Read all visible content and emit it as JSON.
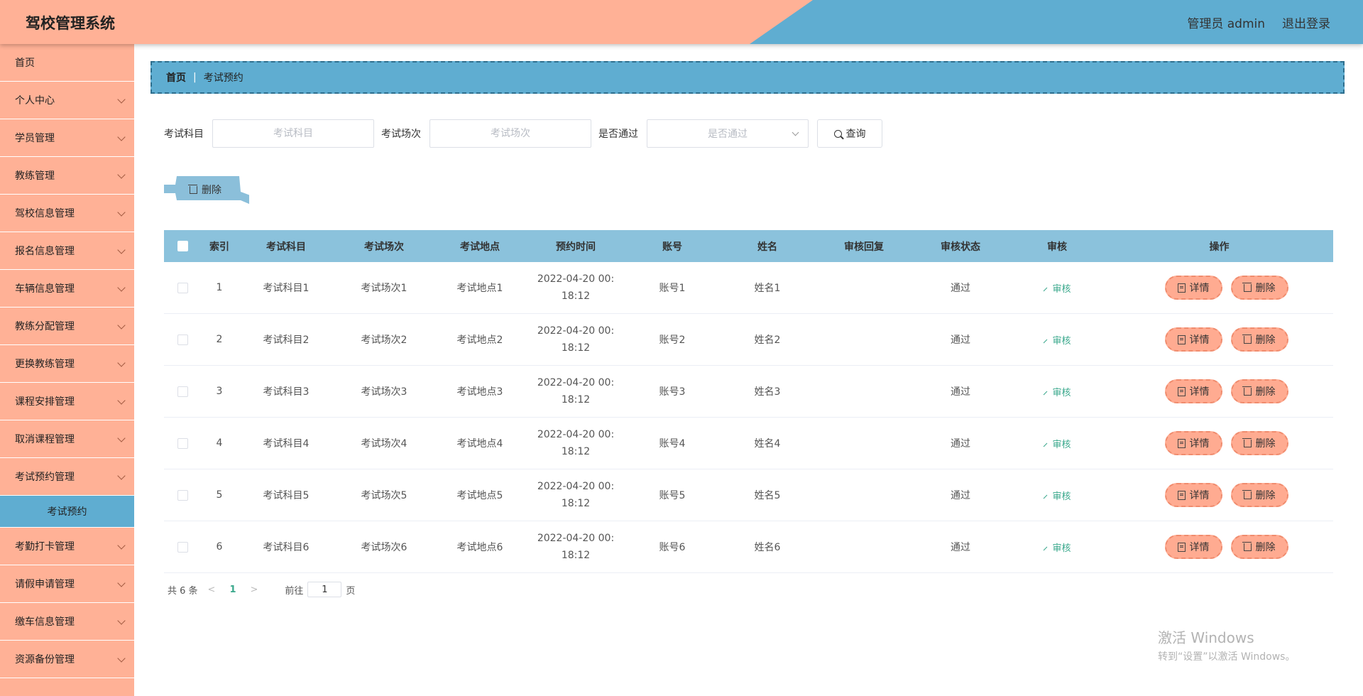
{
  "header": {
    "title": "驾校管理系统",
    "user_label": "管理员 admin",
    "logout_label": "退出登录"
  },
  "sidebar": {
    "items": [
      {
        "label": "首页",
        "type": "link"
      },
      {
        "label": "个人中心",
        "type": "menu"
      },
      {
        "label": "学员管理",
        "type": "menu"
      },
      {
        "label": "教练管理",
        "type": "menu"
      },
      {
        "label": "驾校信息管理",
        "type": "menu"
      },
      {
        "label": "报名信息管理",
        "type": "menu"
      },
      {
        "label": "车辆信息管理",
        "type": "menu"
      },
      {
        "label": "教练分配管理",
        "type": "menu"
      },
      {
        "label": "更换教练管理",
        "type": "menu"
      },
      {
        "label": "课程安排管理",
        "type": "menu"
      },
      {
        "label": "取消课程管理",
        "type": "menu"
      },
      {
        "label": "考试预约管理",
        "type": "menu"
      },
      {
        "label": "考试预约",
        "type": "sub"
      },
      {
        "label": "考勤打卡管理",
        "type": "menu"
      },
      {
        "label": "请假申请管理",
        "type": "menu"
      },
      {
        "label": "缴车信息管理",
        "type": "menu"
      },
      {
        "label": "资源备份管理",
        "type": "menu"
      }
    ]
  },
  "breadcrumb": {
    "home": "首页",
    "separator": "|",
    "current": "考试预约"
  },
  "filters": {
    "subject_label": "考试科目",
    "subject_placeholder": "考试科目",
    "session_label": "考试场次",
    "session_placeholder": "考试场次",
    "passed_label": "是否通过",
    "passed_placeholder": "是否通过",
    "query_label": "查询"
  },
  "actions": {
    "bulk_delete_label": "删除"
  },
  "table": {
    "columns": [
      "",
      "索引",
      "考试科目",
      "考试场次",
      "考试地点",
      "预约时间",
      "账号",
      "姓名",
      "审核回复",
      "审核状态",
      "审核",
      "操作"
    ],
    "review_label": "审核",
    "detail_label": "详情",
    "delete_label": "删除",
    "rows": [
      {
        "index": "1",
        "subject": "考试科目1",
        "session": "考试场次1",
        "location": "考试地点1",
        "time_line1": "2022-04-20 00:",
        "time_line2": "18:12",
        "account": "账号1",
        "name": "姓名1",
        "reply": "",
        "status": "通过"
      },
      {
        "index": "2",
        "subject": "考试科目2",
        "session": "考试场次2",
        "location": "考试地点2",
        "time_line1": "2022-04-20 00:",
        "time_line2": "18:12",
        "account": "账号2",
        "name": "姓名2",
        "reply": "",
        "status": "通过"
      },
      {
        "index": "3",
        "subject": "考试科目3",
        "session": "考试场次3",
        "location": "考试地点3",
        "time_line1": "2022-04-20 00:",
        "time_line2": "18:12",
        "account": "账号3",
        "name": "姓名3",
        "reply": "",
        "status": "通过"
      },
      {
        "index": "4",
        "subject": "考试科目4",
        "session": "考试场次4",
        "location": "考试地点4",
        "time_line1": "2022-04-20 00:",
        "time_line2": "18:12",
        "account": "账号4",
        "name": "姓名4",
        "reply": "",
        "status": "通过"
      },
      {
        "index": "5",
        "subject": "考试科目5",
        "session": "考试场次5",
        "location": "考试地点5",
        "time_line1": "2022-04-20 00:",
        "time_line2": "18:12",
        "account": "账号5",
        "name": "姓名5",
        "reply": "",
        "status": "通过"
      },
      {
        "index": "6",
        "subject": "考试科目6",
        "session": "考试场次6",
        "location": "考试地点6",
        "time_line1": "2022-04-20 00:",
        "time_line2": "18:12",
        "account": "账号6",
        "name": "姓名6",
        "reply": "",
        "status": "通过"
      }
    ]
  },
  "pagination": {
    "total_text": "共 6 条",
    "prev": "<",
    "current_page": "1",
    "next": ">",
    "goto_label": "前往",
    "goto_value": "1",
    "page_suffix": "页"
  },
  "watermark": {
    "line1": "激活 Windows",
    "line2": "转到“设置”以激活 Windows。"
  },
  "colors": {
    "salmon": "#ffb196",
    "blue": "#5fadd1",
    "table_header": "#8bc2dc",
    "op_button": "#ffab91",
    "link_green": "#3aa88c"
  }
}
